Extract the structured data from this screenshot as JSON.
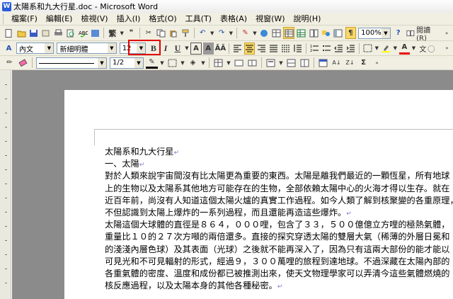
{
  "window": {
    "title": "太陽系和九大行星.doc - Microsoft Word"
  },
  "menu": [
    "檔案(F)",
    "編輯(E)",
    "檢視(V)",
    "插入(I)",
    "格式(O)",
    "工具(T)",
    "表格(A)",
    "視窗(W)",
    "說明(H)"
  ],
  "toolbar_standard": {
    "zoom": "100%",
    "reading_label": "閱讀(R)"
  },
  "toolbar_format": {
    "style": "內文",
    "font": "新細明體",
    "font_size": "12"
  },
  "toolbar_draw": {
    "line_spacing": "1/2"
  },
  "document": {
    "lines": [
      "太陽系和九大行星",
      "一、太陽",
      "對於人類來說宇宙間沒有比太陽更為重要的東西。太陽是離我們最近的一顆恆星，所有地球",
      "上的生物以及太陽系其他地方可能存在的生物，全部依賴太陽中心的火海才得以生存。就在",
      "近百年前，尚沒有人知道這個太陽火爐的真實工作過程。如今人類了解到核聚變的各重原理，",
      "不但認識到太陽上爆炸的一系列過程，而且還能再造這些爆炸。",
      "太陽這個大球體的直徑是８６４，０００哩，包含了３３，５００億億立方哩的極熱氣體，",
      "重量比１０的２７次方噸的兩倍還多。直接的探究穿透太陽的雙層大氣（稀薄的外層日冕和",
      "的淺淺內層色球）及其表面（光球）之後就不能再深入了，因為只有這兩大部份的能才能以",
      "可見光和不可見輻射的形式，經過９，３００萬哩的旅程到達地球。不過深藏在太陽內部的",
      "各重氣體的密度、溫度和成份都已被推測出來，使天文物理學家可以弄清今這些氣體燃燒的",
      "核反應過程，以及太陽本身的其他各種秘密。"
    ]
  }
}
